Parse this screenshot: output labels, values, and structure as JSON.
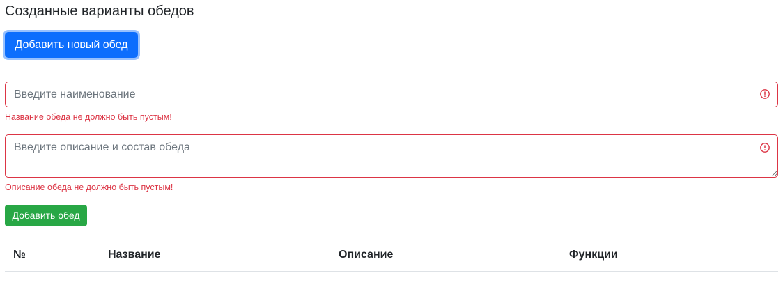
{
  "page": {
    "title": "Созданные варианты обедов"
  },
  "buttons": {
    "add_new_label": "Добавить новый обед",
    "add_label": "Добавить обед"
  },
  "form": {
    "name": {
      "placeholder": "Введите наименование",
      "value": "",
      "error": "Название обеда не должно быть пустым!"
    },
    "description": {
      "placeholder": "Введите описание и состав обеда",
      "value": "",
      "error": "Описание обеда не должно быть пустым!"
    }
  },
  "table": {
    "columns": [
      "№",
      "Название",
      "Описание",
      "Функции"
    ]
  },
  "colors": {
    "primary": "#0d6efd",
    "success": "#28a745",
    "danger": "#dc3545",
    "text": "#212529",
    "placeholder": "#6c757d",
    "border": "#dee2e6"
  },
  "icons": {
    "invalid": "exclamation-circle-icon"
  }
}
